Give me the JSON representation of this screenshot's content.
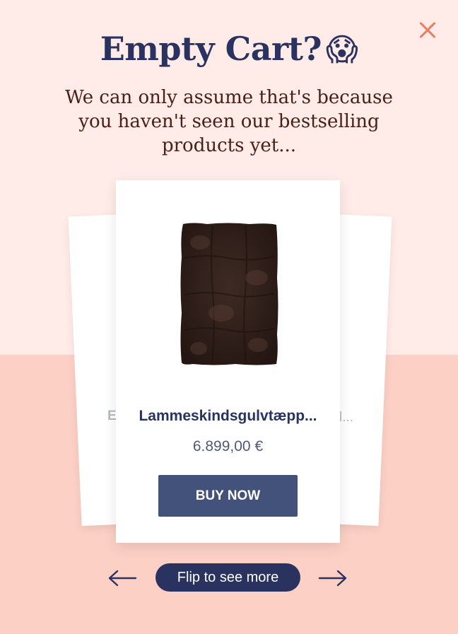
{
  "popup": {
    "title": "Empty Cart?",
    "title_emoji": "😱",
    "subtitle": "We can only assume that's because you haven't seen our bestselling products yet..."
  },
  "carousel": {
    "left_peek_text": "E",
    "right_peek_text": "l...",
    "current": {
      "name": "Lammeskindsgulvtæpp...",
      "price": "6.899,00 €",
      "image_icon": "sheepskin-rug-image",
      "buy_label": "BUY NOW"
    },
    "flip_label": "Flip to see more",
    "prev_icon": "arrow-left-icon",
    "next_icon": "arrow-right-icon"
  },
  "colors": {
    "top_bg": "#ffebe7",
    "bottom_bg": "#fcd0c5",
    "accent_navy": "#2a3260",
    "button_blue": "#43527a",
    "close_orange": "#f07b5e"
  }
}
